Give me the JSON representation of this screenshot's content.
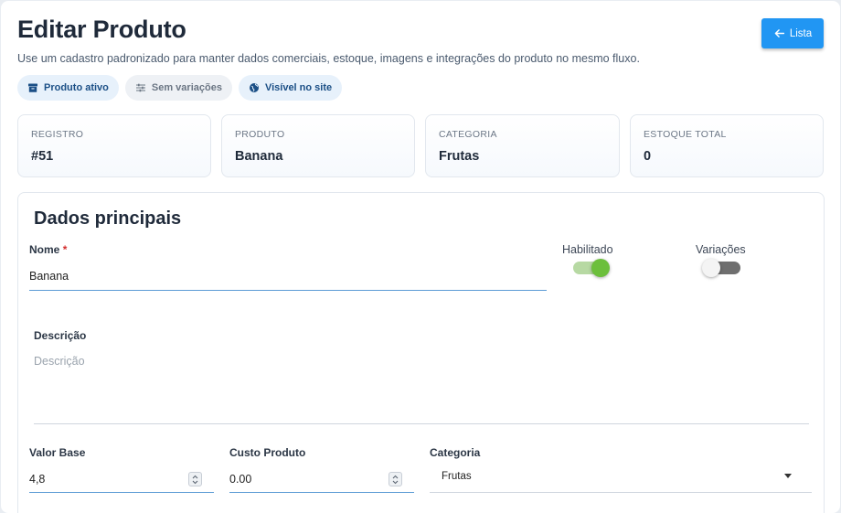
{
  "header": {
    "title": "Editar Produto",
    "subtitle": "Use um cadastro padronizado para manter dados comerciais, estoque, imagens e integrações do produto no mesmo fluxo.",
    "list_button": "Lista"
  },
  "chips": [
    {
      "label": "Produto ativo",
      "icon": "archive-icon"
    },
    {
      "label": "Sem variações",
      "icon": "sliders-icon"
    },
    {
      "label": "Visível no site",
      "icon": "globe-icon"
    }
  ],
  "stats": [
    {
      "label": "Registro",
      "value": "#51"
    },
    {
      "label": "Produto",
      "value": "Banana"
    },
    {
      "label": "Categoria",
      "value": "Frutas"
    },
    {
      "label": "Estoque total",
      "value": "0"
    }
  ],
  "form": {
    "section_title": "Dados principais",
    "name": {
      "label": "Nome",
      "required_mark": "*",
      "value": "Banana"
    },
    "enabled_toggle": {
      "label": "Habilitado",
      "on": true
    },
    "variations_toggle": {
      "label": "Variações",
      "on": false
    },
    "description": {
      "label": "Descrição",
      "placeholder": "Descrição",
      "value": ""
    },
    "base_value": {
      "label": "Valor Base",
      "value": "4,8"
    },
    "product_cost": {
      "label": "Custo Produto",
      "value": "0.00"
    },
    "category": {
      "label": "Categoria",
      "value": "Frutas"
    }
  },
  "colors": {
    "primary": "#2196f3",
    "toggle_on": "#6cbf3c",
    "toggle_off": "#6f6f6f",
    "required": "#d32f2f"
  }
}
